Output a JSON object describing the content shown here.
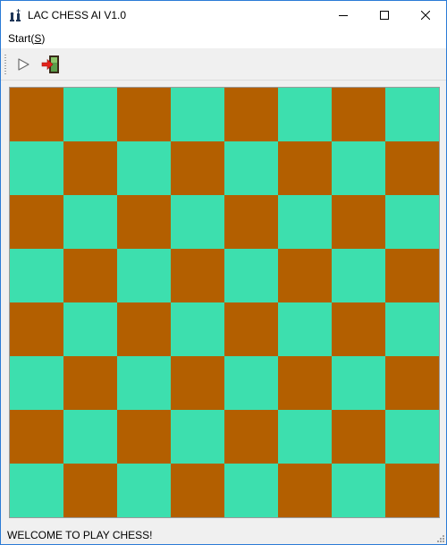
{
  "window": {
    "title": "LAC CHESS AI V1.0"
  },
  "menu": {
    "start_label_prefix": "Start(",
    "start_hotkey": "S",
    "start_label_suffix": ")"
  },
  "toolbar": {
    "buttons": [
      {
        "icon": "play-icon"
      },
      {
        "icon": "exit-door-icon"
      }
    ]
  },
  "board": {
    "rows": 8,
    "cols": 8,
    "dark_color": "#b35f00",
    "light_color": "#3ddfae",
    "top_left": "dark"
  },
  "status": {
    "text": "WELCOME TO PLAY CHESS!"
  }
}
